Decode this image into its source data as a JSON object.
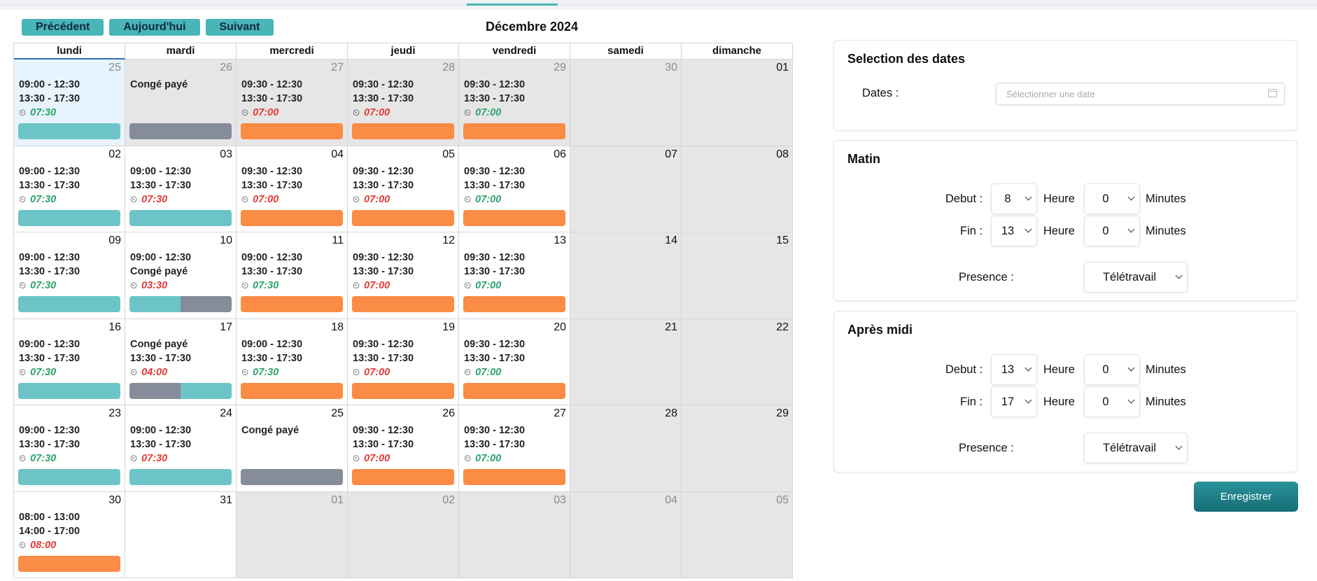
{
  "toolbar": {
    "prev": "Précédent",
    "today": "Aujourd'hui",
    "next": "Suivant"
  },
  "calendar": {
    "title": "Décembre 2024",
    "weekdays": [
      "lundi",
      "mardi",
      "mercredi",
      "jeudi",
      "vendredi",
      "samedi",
      "dimanche"
    ],
    "clock_icon": "clock-icon",
    "days": [
      {
        "num": "25",
        "other": true,
        "today": true,
        "l1": "09:00 - 12:30",
        "l2": "13:30 - 17:30",
        "dur": "07:30",
        "dc": "green",
        "bar": [
          "teal"
        ]
      },
      {
        "num": "26",
        "other": true,
        "l1": "Congé payé",
        "l2": "",
        "dur": "",
        "dc": "",
        "bar": [
          "grey"
        ]
      },
      {
        "num": "27",
        "other": true,
        "l1": "09:30 - 12:30",
        "l2": "13:30 - 17:30",
        "dur": "07:00",
        "dc": "red",
        "bar": [
          "orange"
        ]
      },
      {
        "num": "28",
        "other": true,
        "l1": "09:30 - 12:30",
        "l2": "13:30 - 17:30",
        "dur": "07:00",
        "dc": "red",
        "bar": [
          "orange"
        ]
      },
      {
        "num": "29",
        "other": true,
        "l1": "09:30 - 12:30",
        "l2": "13:30 - 17:30",
        "dur": "07:00",
        "dc": "green",
        "bar": [
          "orange"
        ]
      },
      {
        "num": "30",
        "other": true,
        "weekend": true
      },
      {
        "num": "01",
        "weekend": true
      },
      {
        "num": "02",
        "l1": "09:00 - 12:30",
        "l2": "13:30 - 17:30",
        "dur": "07:30",
        "dc": "green",
        "bar": [
          "teal"
        ]
      },
      {
        "num": "03",
        "l1": "09:00 - 12:30",
        "l2": "13:30 - 17:30",
        "dur": "07:30",
        "dc": "red",
        "bar": [
          "teal"
        ]
      },
      {
        "num": "04",
        "l1": "09:30 - 12:30",
        "l2": "13:30 - 17:30",
        "dur": "07:00",
        "dc": "red",
        "bar": [
          "orange"
        ]
      },
      {
        "num": "05",
        "l1": "09:30 - 12:30",
        "l2": "13:30 - 17:30",
        "dur": "07:00",
        "dc": "red",
        "bar": [
          "orange"
        ]
      },
      {
        "num": "06",
        "l1": "09:30 - 12:30",
        "l2": "13:30 - 17:30",
        "dur": "07:00",
        "dc": "green",
        "bar": [
          "orange"
        ]
      },
      {
        "num": "07",
        "weekend": true
      },
      {
        "num": "08",
        "weekend": true
      },
      {
        "num": "09",
        "l1": "09:00 - 12:30",
        "l2": "13:30 - 17:30",
        "dur": "07:30",
        "dc": "green",
        "bar": [
          "teal"
        ]
      },
      {
        "num": "10",
        "l1": "09:00 - 12:30",
        "l2": "Congé payé",
        "dur": "03:30",
        "dc": "red",
        "bar": [
          "teal",
          "grey"
        ]
      },
      {
        "num": "11",
        "l1": "09:00 - 12:30",
        "l2": "13:30 - 17:30",
        "dur": "07:30",
        "dc": "green",
        "bar": [
          "orange"
        ]
      },
      {
        "num": "12",
        "l1": "09:30 - 12:30",
        "l2": "13:30 - 17:30",
        "dur": "07:00",
        "dc": "red",
        "bar": [
          "orange"
        ]
      },
      {
        "num": "13",
        "l1": "09:30 - 12:30",
        "l2": "13:30 - 17:30",
        "dur": "07:00",
        "dc": "green",
        "bar": [
          "orange"
        ]
      },
      {
        "num": "14",
        "weekend": true
      },
      {
        "num": "15",
        "weekend": true
      },
      {
        "num": "16",
        "l1": "09:00 - 12:30",
        "l2": "13:30 - 17:30",
        "dur": "07:30",
        "dc": "green",
        "bar": [
          "teal"
        ]
      },
      {
        "num": "17",
        "l1": "Congé payé",
        "l2": "13:30 - 17:30",
        "dur": "04:00",
        "dc": "red",
        "bar": [
          "grey",
          "teal"
        ]
      },
      {
        "num": "18",
        "l1": "09:00 - 12:30",
        "l2": "13:30 - 17:30",
        "dur": "07:30",
        "dc": "green",
        "bar": [
          "orange"
        ]
      },
      {
        "num": "19",
        "l1": "09:30 - 12:30",
        "l2": "13:30 - 17:30",
        "dur": "07:00",
        "dc": "red",
        "bar": [
          "orange"
        ]
      },
      {
        "num": "20",
        "l1": "09:30 - 12:30",
        "l2": "13:30 - 17:30",
        "dur": "07:00",
        "dc": "green",
        "bar": [
          "orange"
        ]
      },
      {
        "num": "21",
        "weekend": true
      },
      {
        "num": "22",
        "weekend": true
      },
      {
        "num": "23",
        "l1": "09:00 - 12:30",
        "l2": "13:30 - 17:30",
        "dur": "07:30",
        "dc": "green",
        "bar": [
          "teal"
        ]
      },
      {
        "num": "24",
        "l1": "09:00 - 12:30",
        "l2": "13:30 - 17:30",
        "dur": "07:30",
        "dc": "red",
        "bar": [
          "teal"
        ]
      },
      {
        "num": "25",
        "l1": "Congé payé",
        "l2": "",
        "dur": "",
        "dc": "",
        "bar": [
          "grey"
        ]
      },
      {
        "num": "26",
        "l1": "09:30 - 12:30",
        "l2": "13:30 - 17:30",
        "dur": "07:00",
        "dc": "red",
        "bar": [
          "orange"
        ]
      },
      {
        "num": "27",
        "l1": "09:30 - 12:30",
        "l2": "13:30 - 17:30",
        "dur": "07:00",
        "dc": "green",
        "bar": [
          "orange"
        ]
      },
      {
        "num": "28",
        "weekend": true
      },
      {
        "num": "29",
        "weekend": true
      },
      {
        "num": "30",
        "l1": "08:00 - 13:00",
        "l2": "14:00 - 17:00",
        "dur": "08:00",
        "dc": "red",
        "bar": [
          "orange"
        ]
      },
      {
        "num": "31"
      },
      {
        "num": "01",
        "other": true,
        "weekend": true
      },
      {
        "num": "02",
        "other": true,
        "weekend": true
      },
      {
        "num": "03",
        "other": true,
        "weekend": true
      },
      {
        "num": "04",
        "other": true,
        "weekend": true
      },
      {
        "num": "05",
        "other": true,
        "weekend": true
      }
    ]
  },
  "colors": {
    "teal": "#6cc4c7",
    "orange": "#fa8c45",
    "grey": "#868c99",
    "green_text": "#2ca36b",
    "red_text": "#e53935",
    "accent": "#48b5b8"
  },
  "dates_panel": {
    "title": "Selection des dates",
    "label": "Dates :",
    "placeholder": "Sélectionner une date"
  },
  "morning": {
    "title": "Matin",
    "debut_label": "Debut :",
    "debut_hour": "8",
    "debut_min": "0",
    "fin_label": "Fin :",
    "fin_hour": "13",
    "fin_min": "0",
    "hour_unit": "Heure",
    "min_unit": "Minutes",
    "presence_label": "Presence :",
    "presence_value": "Télétravail"
  },
  "afternoon": {
    "title": "Après midi",
    "debut_label": "Debut :",
    "debut_hour": "13",
    "debut_min": "0",
    "fin_label": "Fin :",
    "fin_hour": "17",
    "fin_min": "0",
    "hour_unit": "Heure",
    "min_unit": "Minutes",
    "presence_label": "Presence :",
    "presence_value": "Télétravail"
  },
  "save_label": "Enregistrer"
}
